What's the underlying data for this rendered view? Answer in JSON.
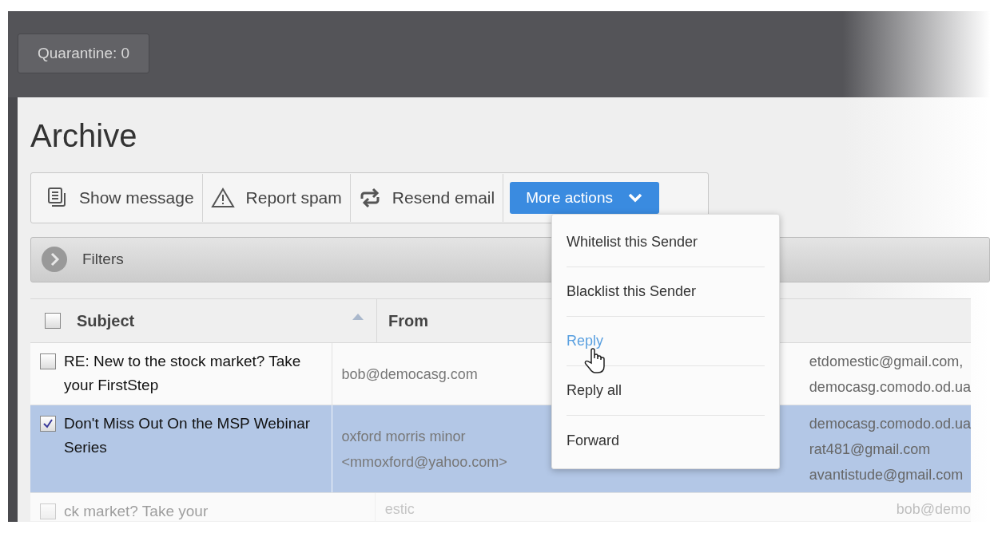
{
  "header": {
    "quarantine_button": "Quarantine: 0"
  },
  "page_title": "Archive",
  "toolbar": [
    {
      "kind": "message",
      "label": "Show message"
    },
    {
      "kind": "warning",
      "label": "Report spam"
    },
    {
      "kind": "resend",
      "label": "Resend email"
    },
    {
      "kind": "dropdown",
      "label": "More actions",
      "expanded": true
    }
  ],
  "filters": {
    "label": "Filters",
    "expanded": false
  },
  "table": {
    "columns": [
      {
        "label": "Subject",
        "sorted": true
      },
      {
        "label": "From",
        "sorted": false
      }
    ],
    "select_all_checked": false,
    "rows": [
      {
        "selected": false,
        "faded": false,
        "subject": "RE: New to the stock market? Take your FirstStep",
        "from": [
          "bob@democasg.com"
        ],
        "to": [
          "etdomestic@gmail.com,",
          "democasg.comodo.od.ua"
        ]
      },
      {
        "selected": true,
        "faded": false,
        "subject": "Don't Miss Out On the MSP Webinar Series",
        "from": [
          "oxford morris minor",
          "<mmoxford@yahoo.com>"
        ],
        "to": [
          "democasg.comodo.od.ua",
          "rat481@gmail.com",
          "avantistude@gmail.com"
        ]
      },
      {
        "selected": false,
        "faded": true,
        "subject": "ck market? Take your",
        "from": [
          "estic"
        ],
        "to": [
          "bob@demo"
        ]
      }
    ]
  },
  "menu": {
    "items": [
      {
        "label": "Whitelist this Sender",
        "hovered": false
      },
      {
        "label": "Blacklist this Sender",
        "hovered": false
      },
      {
        "label": "Reply",
        "hovered": true
      },
      {
        "label": "Reply all",
        "hovered": false
      },
      {
        "label": "Forward",
        "hovered": false
      }
    ]
  }
}
